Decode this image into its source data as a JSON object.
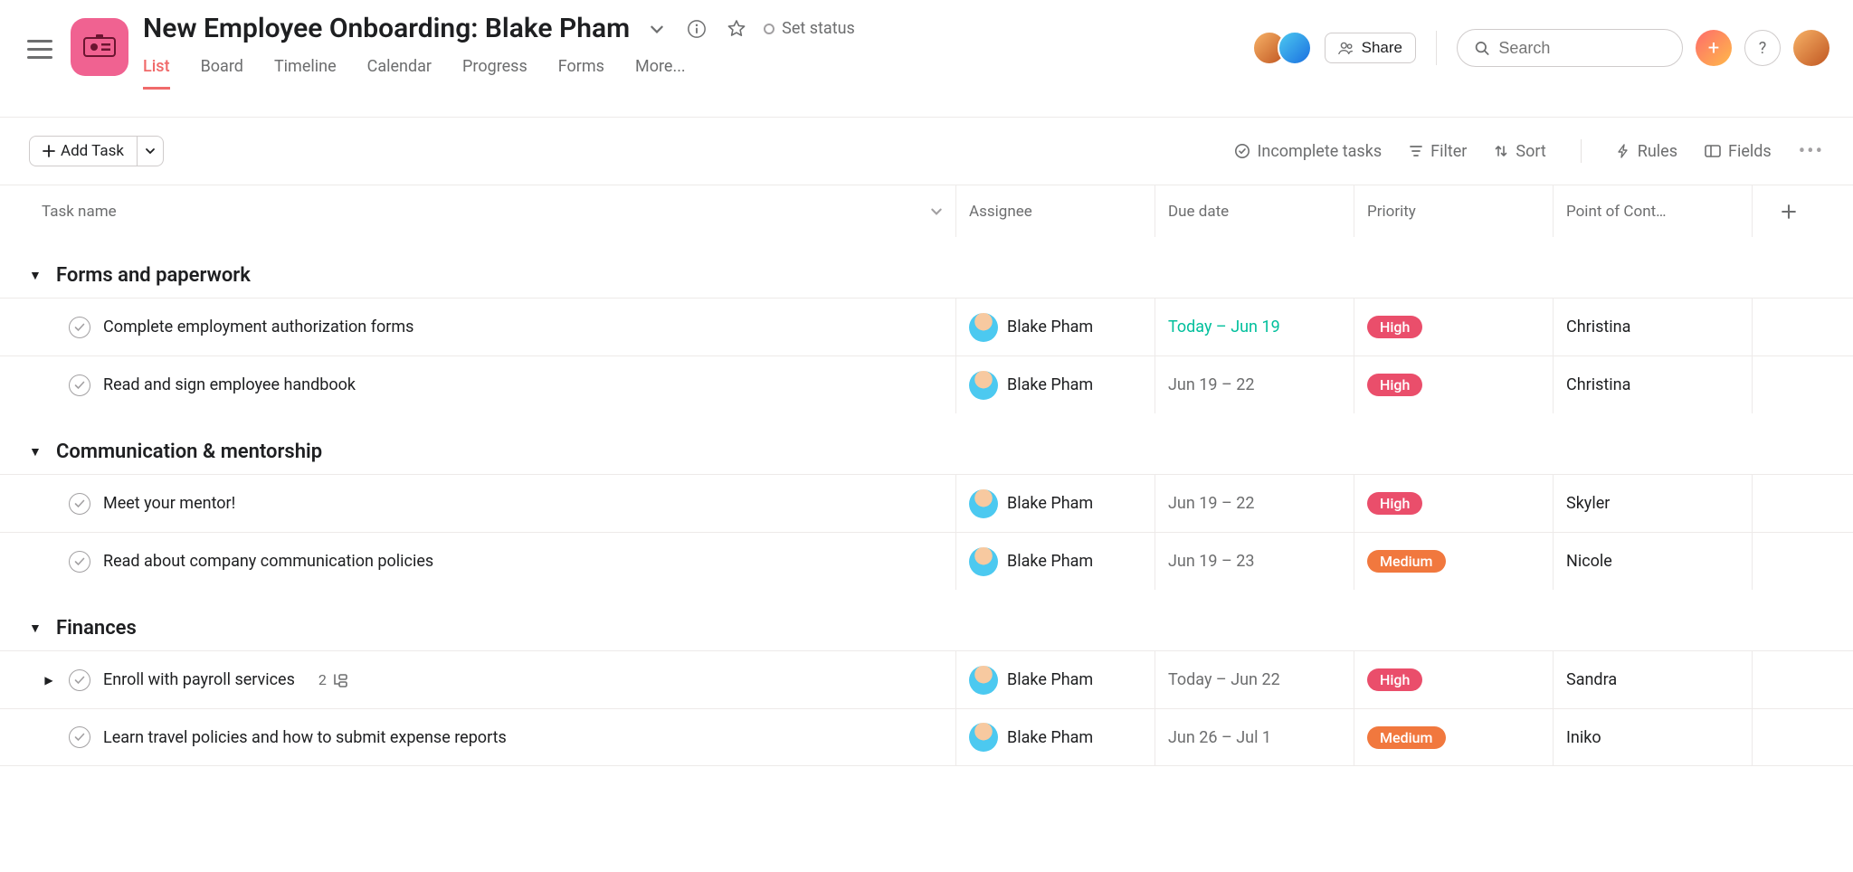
{
  "project": {
    "title": "New Employee Onboarding: Blake Pham",
    "set_status": "Set status"
  },
  "tabs": [
    "List",
    "Board",
    "Timeline",
    "Calendar",
    "Progress",
    "Forms",
    "More..."
  ],
  "active_tab": "List",
  "share_label": "Share",
  "search_placeholder": "Search",
  "add_task_label": "Add Task",
  "toolbar": {
    "incomplete": "Incomplete tasks",
    "filter": "Filter",
    "sort": "Sort",
    "rules": "Rules",
    "fields": "Fields"
  },
  "columns": {
    "task_name": "Task name",
    "assignee": "Assignee",
    "due_date": "Due date",
    "priority": "Priority",
    "poc": "Point of Cont…"
  },
  "sections": [
    {
      "title": "Forms and paperwork",
      "collapsed": false,
      "tasks": [
        {
          "name": "Complete employment authorization forms",
          "assignee": "Blake Pham",
          "due": "Today – Jun 19",
          "due_today": true,
          "priority": "High",
          "poc": "Christina",
          "subtasks": null,
          "has_children": false
        },
        {
          "name": "Read and sign employee handbook",
          "assignee": "Blake Pham",
          "due": "Jun 19 – 22",
          "due_today": false,
          "priority": "High",
          "poc": "Christina",
          "subtasks": null,
          "has_children": false
        }
      ]
    },
    {
      "title": "Communication & mentorship",
      "collapsed": false,
      "tasks": [
        {
          "name": "Meet your mentor!",
          "assignee": "Blake Pham",
          "due": "Jun 19 – 22",
          "due_today": false,
          "priority": "High",
          "poc": "Skyler",
          "subtasks": null,
          "has_children": false
        },
        {
          "name": "Read about company communication policies",
          "assignee": "Blake Pham",
          "due": "Jun 19 – 23",
          "due_today": false,
          "priority": "Medium",
          "poc": "Nicole",
          "subtasks": null,
          "has_children": false
        }
      ]
    },
    {
      "title": "Finances",
      "collapsed": false,
      "tasks": [
        {
          "name": "Enroll with payroll services",
          "assignee": "Blake Pham",
          "due": "Today – Jun 22",
          "due_today": false,
          "priority": "High",
          "poc": "Sandra",
          "subtasks": 2,
          "has_children": true
        },
        {
          "name": "Learn travel policies and how to submit expense reports",
          "assignee": "Blake Pham",
          "due": "Jun 26 – Jul 1",
          "due_today": false,
          "priority": "Medium",
          "poc": "Iniko",
          "subtasks": null,
          "has_children": false
        }
      ]
    }
  ]
}
